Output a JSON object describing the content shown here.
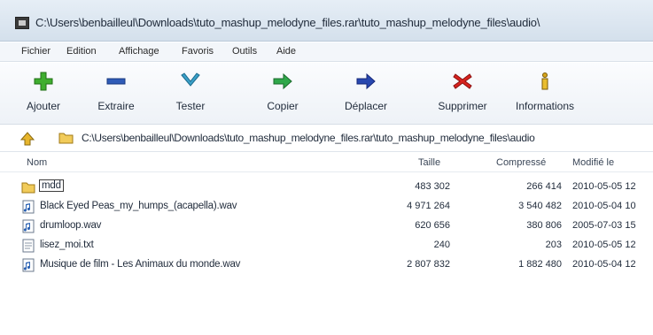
{
  "window": {
    "title": "C:\\Users\\benbailleul\\Downloads\\tuto_mashup_melodyne_files.rar\\tuto_mashup_melodyne_files\\audio\\"
  },
  "menu": {
    "items": [
      "Fichier",
      "Edition",
      "Affichage",
      "Favoris",
      "Outils",
      "Aide"
    ]
  },
  "toolbar": {
    "ajouter": "Ajouter",
    "extraire": "Extraire",
    "tester": "Tester",
    "copier": "Copier",
    "deplacer": "Déplacer",
    "supprimer": "Supprimer",
    "informations": "Informations"
  },
  "address": {
    "path": "C:\\Users\\benbailleul\\Downloads\\tuto_mashup_melodyne_files.rar\\tuto_mashup_melodyne_files\\audio"
  },
  "columns": {
    "name": "Nom",
    "size": "Taille",
    "packed": "Compressé",
    "modified": "Modifié le"
  },
  "files": [
    {
      "name": "mdd",
      "type": "folder",
      "size": "483 302",
      "packed": "266 414",
      "modified": "2010-05-05 12"
    },
    {
      "name": "Black Eyed Peas_my_humps_(acapella).wav",
      "type": "audio",
      "size": "4 971 264",
      "packed": "3 540 482",
      "modified": "2010-05-04 10"
    },
    {
      "name": "drumloop.wav",
      "type": "audio",
      "size": "620 656",
      "packed": "380 806",
      "modified": "2005-07-03 15"
    },
    {
      "name": "lisez_moi.txt",
      "type": "text",
      "size": "240",
      "packed": "203",
      "modified": "2010-05-05 12"
    },
    {
      "name": "Musique de film - Les Animaux du monde.wav",
      "type": "audio",
      "size": "2 807 832",
      "packed": "1 882 480",
      "modified": "2010-05-04 12"
    }
  ]
}
